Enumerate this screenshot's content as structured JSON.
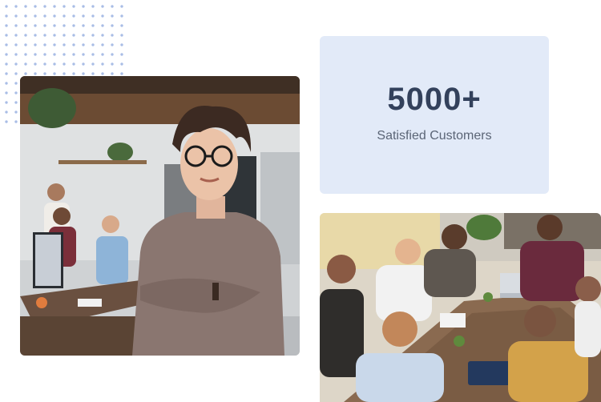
{
  "stats": {
    "number": "5000+",
    "label": "Satisfied Customers"
  },
  "images": {
    "main": "businesswoman-arms-crossed-photo",
    "team": "team-meeting-photo"
  },
  "colors": {
    "card_background": "#e2eaf8",
    "number_text": "#33415c",
    "label_text": "#5b6576",
    "dot_pattern": "#a9bde6"
  }
}
